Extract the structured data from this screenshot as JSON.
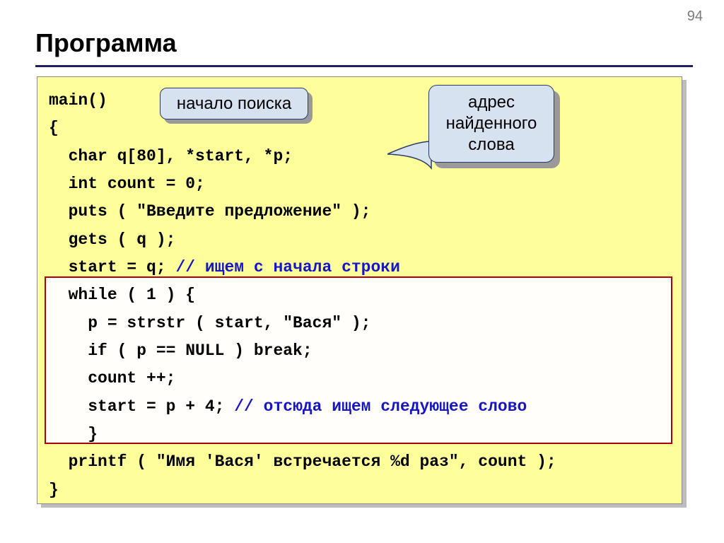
{
  "page_number": "94",
  "title": "Программа",
  "callout1": "начало поиска",
  "callout2_l1": "адрес",
  "callout2_l2": "найденного",
  "callout2_l3": "слова",
  "code": {
    "l1": "main()",
    "l2": "{",
    "l3": "  char q[80], *start, *p;",
    "l4": "  int count = 0;",
    "l5": "  puts ( \"Введите предложение\" );",
    "l6": "  gets ( q );",
    "l7a": "  start = q; ",
    "l7b": "// ищем с начала строки",
    "l8": "  while ( 1 ) {",
    "l9": "    p = strstr ( start, \"Вася\" );",
    "l10": "    if ( p == NULL ) break;",
    "l11": "    count ++;",
    "l12a": "    start = p + 4; ",
    "l12b": "// отсюда ищем следующее слово",
    "l13": "    }",
    "l14": "  printf ( \"Имя 'Вася' встречается %d раз\", count );",
    "l15": "}"
  }
}
